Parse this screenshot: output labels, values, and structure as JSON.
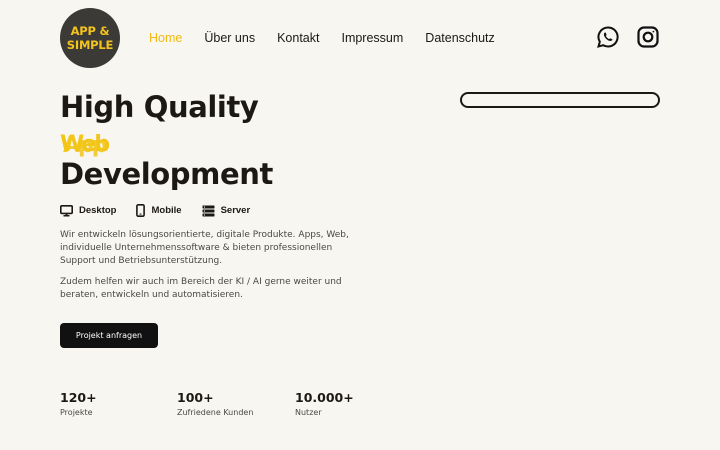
{
  "header": {
    "logo": {
      "line1": "APP &",
      "line2": "SIMPLE"
    },
    "nav": [
      {
        "label": "Home",
        "active": true
      },
      {
        "label": "Über uns"
      },
      {
        "label": "Kontakt"
      },
      {
        "label": "Impressum"
      },
      {
        "label": "Datenschutz"
      }
    ],
    "social": [
      "whatsapp-icon",
      "instagram-icon"
    ]
  },
  "hero": {
    "title_line1": "High Quality",
    "title_accent_a": "Web",
    "title_accent_b": "App",
    "title_line3": "Development",
    "platforms": [
      {
        "icon": "desktop-icon",
        "label": "Desktop"
      },
      {
        "icon": "mobile-icon",
        "label": "Mobile"
      },
      {
        "icon": "server-icon",
        "label": "Server"
      }
    ],
    "paragraph1": "Wir entwickeln lösungsorientierte, digitale Produkte. Apps, Web, individuelle Unternehmenssoftware & bieten professionellen Support und Betriebsunterstützung.",
    "paragraph2": "Zudem helfen wir auch im Bereich der KI / AI gerne weiter und beraten, entwickeln und automatisieren.",
    "cta_label": "Projekt anfragen"
  },
  "stats": [
    {
      "value": "120+",
      "label": "Projekte"
    },
    {
      "value": "100+",
      "label": "Zufriedene Kunden"
    },
    {
      "value": "10.000+",
      "label": "Nutzer"
    }
  ],
  "colors": {
    "background": "#f8f6f1",
    "accent": "#f2c518",
    "text": "#1c1914",
    "button": "#111111"
  }
}
